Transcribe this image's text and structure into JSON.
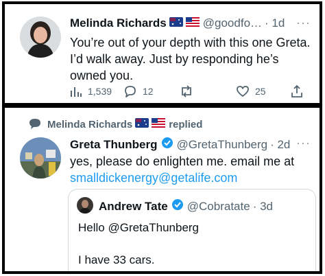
{
  "top_tweet": {
    "author_name": "Melinda Richards",
    "handle": "@goodfo…",
    "time": "· 1d",
    "more": "···",
    "text_line1": "You’re out of your depth with this one Greta.",
    "text_line2": "I’d walk away. Just by responding he’s",
    "text_line3": "owned you.",
    "views": "1,539",
    "replies": "12",
    "likes": "25"
  },
  "reply_context": {
    "label_name": "Melinda Richards",
    "label_action": "replied"
  },
  "reply_tweet": {
    "author_name": "Greta Thunberg",
    "handle": "@GretaThunberg",
    "time": "· 2d",
    "more": "···",
    "text_line1": "yes, please do enlighten me. email me at",
    "link": "smalldickenergy@getalife.com"
  },
  "quoted_tweet": {
    "author_name": "Andrew Tate",
    "handle": "@Cobratate",
    "time": "· 3d",
    "text_line1": "Hello @GretaThunberg",
    "text_line2": "I have 33 cars."
  },
  "colors": {
    "accent": "#1d9bf0",
    "muted": "#536471",
    "verified": "#1d9bf0"
  }
}
